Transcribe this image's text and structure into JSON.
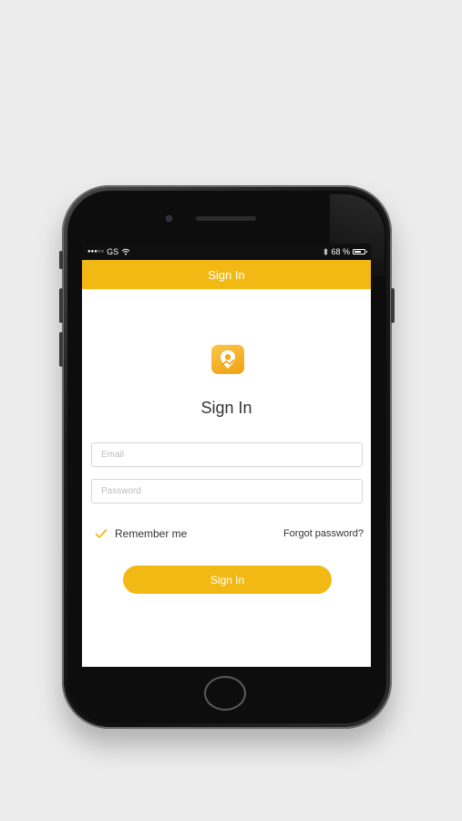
{
  "status_bar": {
    "carrier": "GS",
    "signal_icon": "signal-dots-icon",
    "wifi_icon": "wifi-icon",
    "bluetooth_icon": "bluetooth-icon",
    "battery_text": "68 %",
    "battery_icon": "battery-icon"
  },
  "nav": {
    "title": "Sign In"
  },
  "logo": {
    "icon": "location-pin-logo-icon"
  },
  "page": {
    "title": "Sign In"
  },
  "form": {
    "email_placeholder": "Email",
    "password_placeholder": "Password",
    "remember_label": "Remember me",
    "remember_checked": true,
    "forgot_label": "Forgot password?",
    "submit_label": "Sign In"
  },
  "colors": {
    "accent": "#f2b915",
    "background": "#ececec",
    "text": "#333333"
  }
}
